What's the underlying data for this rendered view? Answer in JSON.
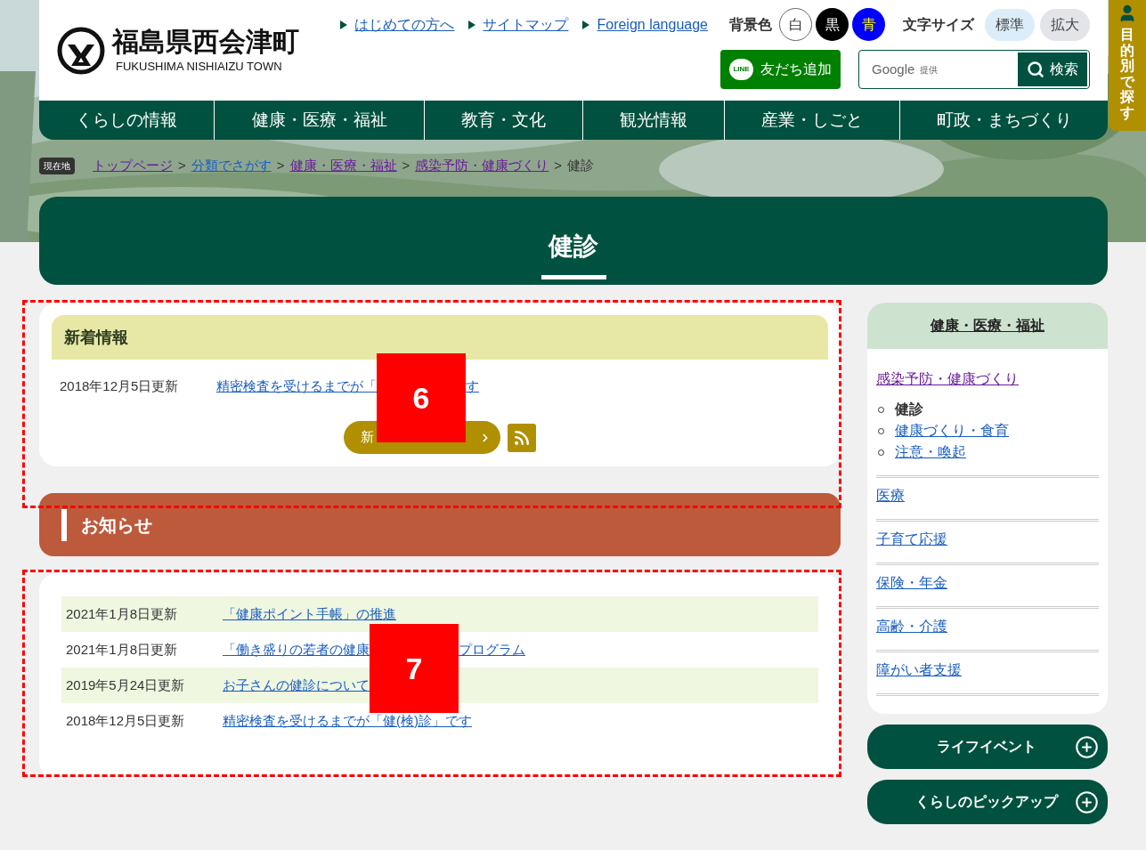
{
  "header": {
    "logo_title": "福島県西会津町",
    "logo_subtitle": "FUKUSHIMA NISHIAIZU TOWN",
    "top_links": [
      "はじめての方へ",
      "サイトマップ",
      "Foreign language"
    ],
    "bg_color_label": "背景色",
    "bg_colors": [
      {
        "label": "白",
        "kind": "white"
      },
      {
        "label": "黒",
        "kind": "black"
      },
      {
        "label": "青",
        "kind": "blue"
      }
    ],
    "font_size_label": "文字サイズ",
    "font_sizes": [
      {
        "label": "標準",
        "selected": true
      },
      {
        "label": "拡大",
        "selected": false
      }
    ],
    "line_button": "友だち追加",
    "line_badge": "LINE",
    "search": {
      "placeholder": "Google",
      "placeholder_note": "提供",
      "button": "検索"
    },
    "side_tab": "目的別で探す"
  },
  "nav": [
    "くらしの情報",
    "健康・医療・福祉",
    "教育・文化",
    "観光情報",
    "産業・しごと",
    "町政・まちづくり"
  ],
  "breadcrumb": {
    "label": "現在地",
    "separator": ">",
    "items": [
      {
        "text": "トップページ",
        "visited": true
      },
      {
        "text": "分類でさがす",
        "visited": false
      },
      {
        "text": "健康・医療・福祉",
        "visited": true
      },
      {
        "text": "感染予防・健康づくり",
        "visited": true
      }
    ],
    "current": "健診"
  },
  "page_title": "健診",
  "news": {
    "title": "新着情報",
    "items": [
      {
        "date": "2018年12月5日更新",
        "link_parts": [
          "精密検査を受けるまでが「",
          "す"
        ]
      }
    ],
    "more_button": "新"
  },
  "notice": {
    "title": "お知らせ",
    "items": [
      {
        "date": "2021年1月8日更新",
        "link_parts": [
          "「健康ポイント手帳」の推進"
        ]
      },
      {
        "date": "2021年1月8日更新",
        "link_parts": [
          "「働き盛りの若者の健康",
          "プログラム"
        ]
      },
      {
        "date": "2019年5月24日更新",
        "link_parts": [
          "お子さんの健診について"
        ]
      },
      {
        "date": "2018年12月5日更新",
        "link_parts": [
          "精密検査を受けるまでが「健(検)診」です"
        ]
      }
    ]
  },
  "sidebar": {
    "title": "健康・医療・福祉",
    "sections": [
      {
        "text": "感染予防・健康づくり",
        "visited": true,
        "children": [
          {
            "text": "健診",
            "current": true
          },
          {
            "text": "健康づくり・食育",
            "current": false
          },
          {
            "text": "注意・喚起",
            "current": false
          }
        ]
      },
      {
        "text": "医療",
        "visited": false
      },
      {
        "text": "子育て応援",
        "visited": false
      },
      {
        "text": "保険・年金",
        "visited": false
      },
      {
        "text": "高齢・介護",
        "visited": false
      },
      {
        "text": "障がい者支援",
        "visited": false
      }
    ]
  },
  "side_buttons": [
    "ライフイベント",
    "くらしのピックアップ"
  ],
  "annotations": [
    {
      "label": "6"
    },
    {
      "label": "7"
    }
  ]
}
